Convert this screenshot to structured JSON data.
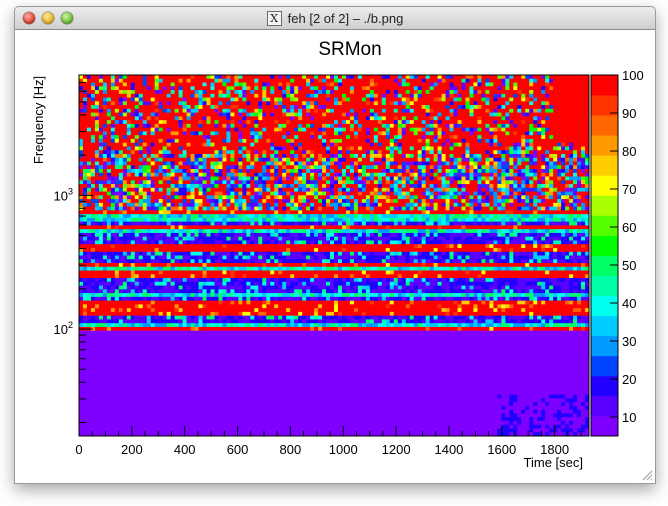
{
  "window": {
    "title": "feh [2 of 2] – ./b.png",
    "controls": {
      "close": "close-button",
      "minimize": "minimize-button",
      "zoom": "zoom-button"
    },
    "icon": "x11-icon"
  },
  "plot": {
    "title": "SRMon",
    "ylabel": "Frequency [Hz]",
    "xlabel": "Time [sec]",
    "xticks": [
      "0",
      "200",
      "400",
      "600",
      "800",
      "1000",
      "1200",
      "1400",
      "1600",
      "1800"
    ],
    "yticks": [
      {
        "base": "10",
        "exp": "3"
      },
      {
        "base": "10",
        "exp": "2"
      }
    ],
    "zticks": [
      "100",
      "90",
      "80",
      "70",
      "60",
      "50",
      "40",
      "30",
      "20",
      "10"
    ]
  },
  "chart_data": {
    "type": "heatmap",
    "title": "SRMon",
    "xlabel": "Time [sec]",
    "ylabel": "Frequency [Hz]",
    "xlim": [
      0,
      1930
    ],
    "y_scale": "log",
    "zlim": [
      5,
      100
    ],
    "palette": [
      "#7f00ff",
      "#5a00ff",
      "#2200ff",
      "#0044ff",
      "#0099ff",
      "#00ccff",
      "#00ffee",
      "#00ffaa",
      "#00ff66",
      "#00ff00",
      "#55ff00",
      "#aaff00",
      "#ffff00",
      "#ffcc00",
      "#ff9900",
      "#ff6600",
      "#ff3300",
      "#ff0000"
    ],
    "bands": [
      {
        "from_log": 3.3,
        "to_log": 3.9,
        "description": "high frequencies mostly saturated near 100"
      },
      {
        "from_log": 2.9,
        "to_log": 3.3,
        "description": "mixed values 10–100"
      },
      {
        "from_log": 2.0,
        "to_log": 2.9,
        "description": "alternating bands of high and low values"
      },
      {
        "from_log": 1.2,
        "to_log": 2.0,
        "description": "uniform low values near 5"
      }
    ]
  }
}
